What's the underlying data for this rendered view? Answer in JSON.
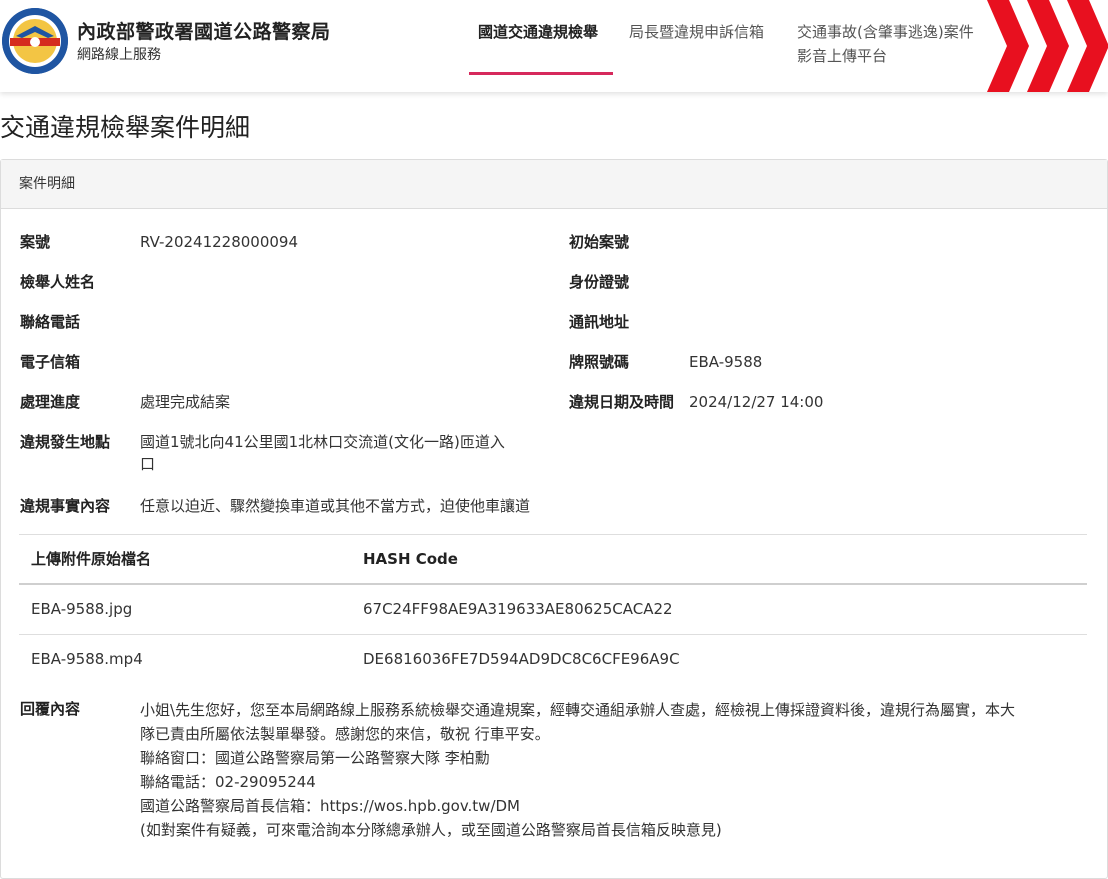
{
  "header": {
    "title": "內政部警政署國道公路警察局",
    "subtitle": "網路線上服務",
    "nav": [
      {
        "label": "國道交通違規檢舉",
        "active": true
      },
      {
        "label": "局長暨違規申訴信箱",
        "active": false
      },
      {
        "label_line1": "交通事故(含肇事逃逸)案件",
        "label_line2": "影音上傳平台",
        "active": false
      }
    ],
    "accent_color": "#d6295c",
    "chevron_color": "#e8101f"
  },
  "page_title": "交通違規檢舉案件明細",
  "panel": {
    "heading": "案件明細",
    "fields": {
      "case_no": {
        "label": "案號",
        "value": "RV-20241228000094"
      },
      "initial_case_no": {
        "label": "初始案號",
        "value": ""
      },
      "reporter_name": {
        "label": "檢舉人姓名",
        "value": ""
      },
      "id_no": {
        "label": "身份證號",
        "value": ""
      },
      "phone": {
        "label": "聯絡電話",
        "value": ""
      },
      "address": {
        "label": "通訊地址",
        "value": ""
      },
      "email": {
        "label": "電子信箱",
        "value": ""
      },
      "plate": {
        "label": "牌照號碼",
        "value": "EBA-9588"
      },
      "progress": {
        "label": "處理進度",
        "value": "處理完成結案"
      },
      "violation_time": {
        "label": "違規日期及時間",
        "value": "2024/12/27 14:00"
      },
      "location": {
        "label": "違規發生地點",
        "value_line1": "國道1號北向41公里國1北林口交流道(文化一路)匝道入",
        "value_line2": "口"
      },
      "facts": {
        "label": "違規事實內容",
        "value": "任意以迫近、驟然變換車道或其他不當方式，迫使他車讓道"
      }
    },
    "attachments": {
      "columns": [
        "上傳附件原始檔名",
        "HASH Code"
      ],
      "rows": [
        [
          "EBA-9588.jpg",
          "67C24FF98AE9A319633AE80625CACA22"
        ],
        [
          "EBA-9588.mp4",
          "DE6816036FE7D594AD9DC8C6CFE96A9C"
        ]
      ]
    },
    "reply": {
      "label": "回覆內容",
      "lines": [
        "小姐\\先生您好，您至本局網路線上服務系統檢舉交通違規案，經轉交通組承辦人查處，經檢視上傳採證資料後，違規行為屬實，本大",
        "隊已責由所屬依法製單舉發。感謝您的來信，敬祝 行車平安。",
        "聯絡窗口：國道公路警察局第一公路警察大隊 李柏勳",
        "聯絡電話：02-29095244",
        "國道公路警察局首長信箱：https://wos.hpb.gov.tw/DM",
        "(如對案件有疑義，可來電洽詢本分隊總承辦人，或至國道公路警察局首長信箱反映意見)"
      ]
    }
  }
}
